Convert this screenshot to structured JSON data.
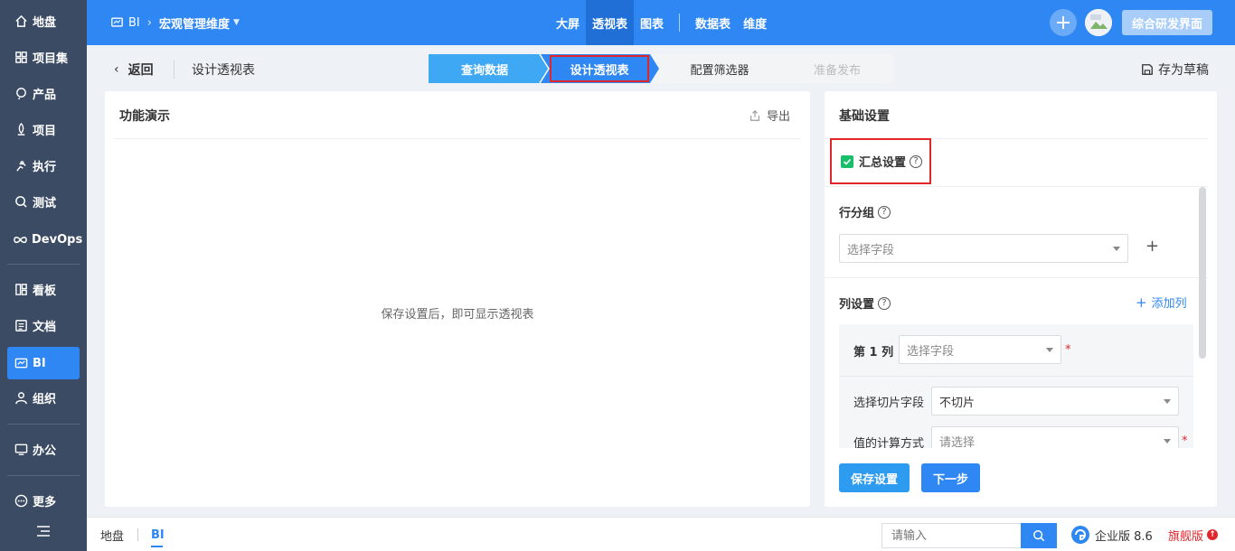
{
  "sidebar": {
    "items": [
      {
        "label": "地盘",
        "icon": "home-icon"
      },
      {
        "label": "项目集",
        "icon": "grid-icon"
      },
      {
        "label": "产品",
        "icon": "product-icon"
      },
      {
        "label": "项目",
        "icon": "project-icon"
      },
      {
        "label": "执行",
        "icon": "run-icon"
      },
      {
        "label": "测试",
        "icon": "test-icon"
      },
      {
        "label": "DevOps",
        "icon": "infinity-icon"
      },
      {
        "label": "看板",
        "icon": "kanban-icon"
      },
      {
        "label": "文档",
        "icon": "doc-icon"
      },
      {
        "label": "BI",
        "icon": "bi-icon"
      },
      {
        "label": "组织",
        "icon": "org-icon"
      },
      {
        "label": "办公",
        "icon": "office-icon"
      },
      {
        "label": "更多",
        "icon": "more-icon"
      }
    ],
    "active": "BI"
  },
  "topbar": {
    "app": "BI",
    "project": "宏观管理维度",
    "nav": [
      "大屏",
      "透视表",
      "图表",
      "数据表",
      "维度"
    ],
    "active_nav": "透视表",
    "main_button": "综合研发界面"
  },
  "subheader": {
    "back": "返回",
    "title": "设计透视表",
    "save_draft": "存为草稿",
    "steps": [
      "查询数据",
      "设计透视表",
      "配置筛选器",
      "准备发布"
    ]
  },
  "preview": {
    "title": "功能演示",
    "export": "导出",
    "empty_text": "保存设置后，即可显示透视表"
  },
  "settings": {
    "title": "基础设置",
    "summary_label": "汇总设置",
    "summary_checked": true,
    "row_group_label": "行分组",
    "row_group_placeholder": "选择字段",
    "column_label": "列设置",
    "add_column": "添加列",
    "col1_label": "第 1 列",
    "col1_placeholder": "选择字段",
    "slice_label": "选择切片字段",
    "slice_value": "不切片",
    "calc_label": "值的计算方式",
    "calc_placeholder": "请选择",
    "save_button": "保存设置",
    "next_button": "下一步"
  },
  "bottombar": {
    "tabs": [
      "地盘",
      "BI"
    ],
    "active_tab": "BI",
    "search_placeholder": "请输入",
    "edition": "企业版 8.6",
    "flagship": "旗舰版"
  },
  "colors": {
    "primary": "#2f87f4",
    "sidebar_bg": "#3b4b63",
    "highlight_border": "#e1262b",
    "step_done": "#3ea8f5",
    "step_active": "#2f87f4"
  }
}
